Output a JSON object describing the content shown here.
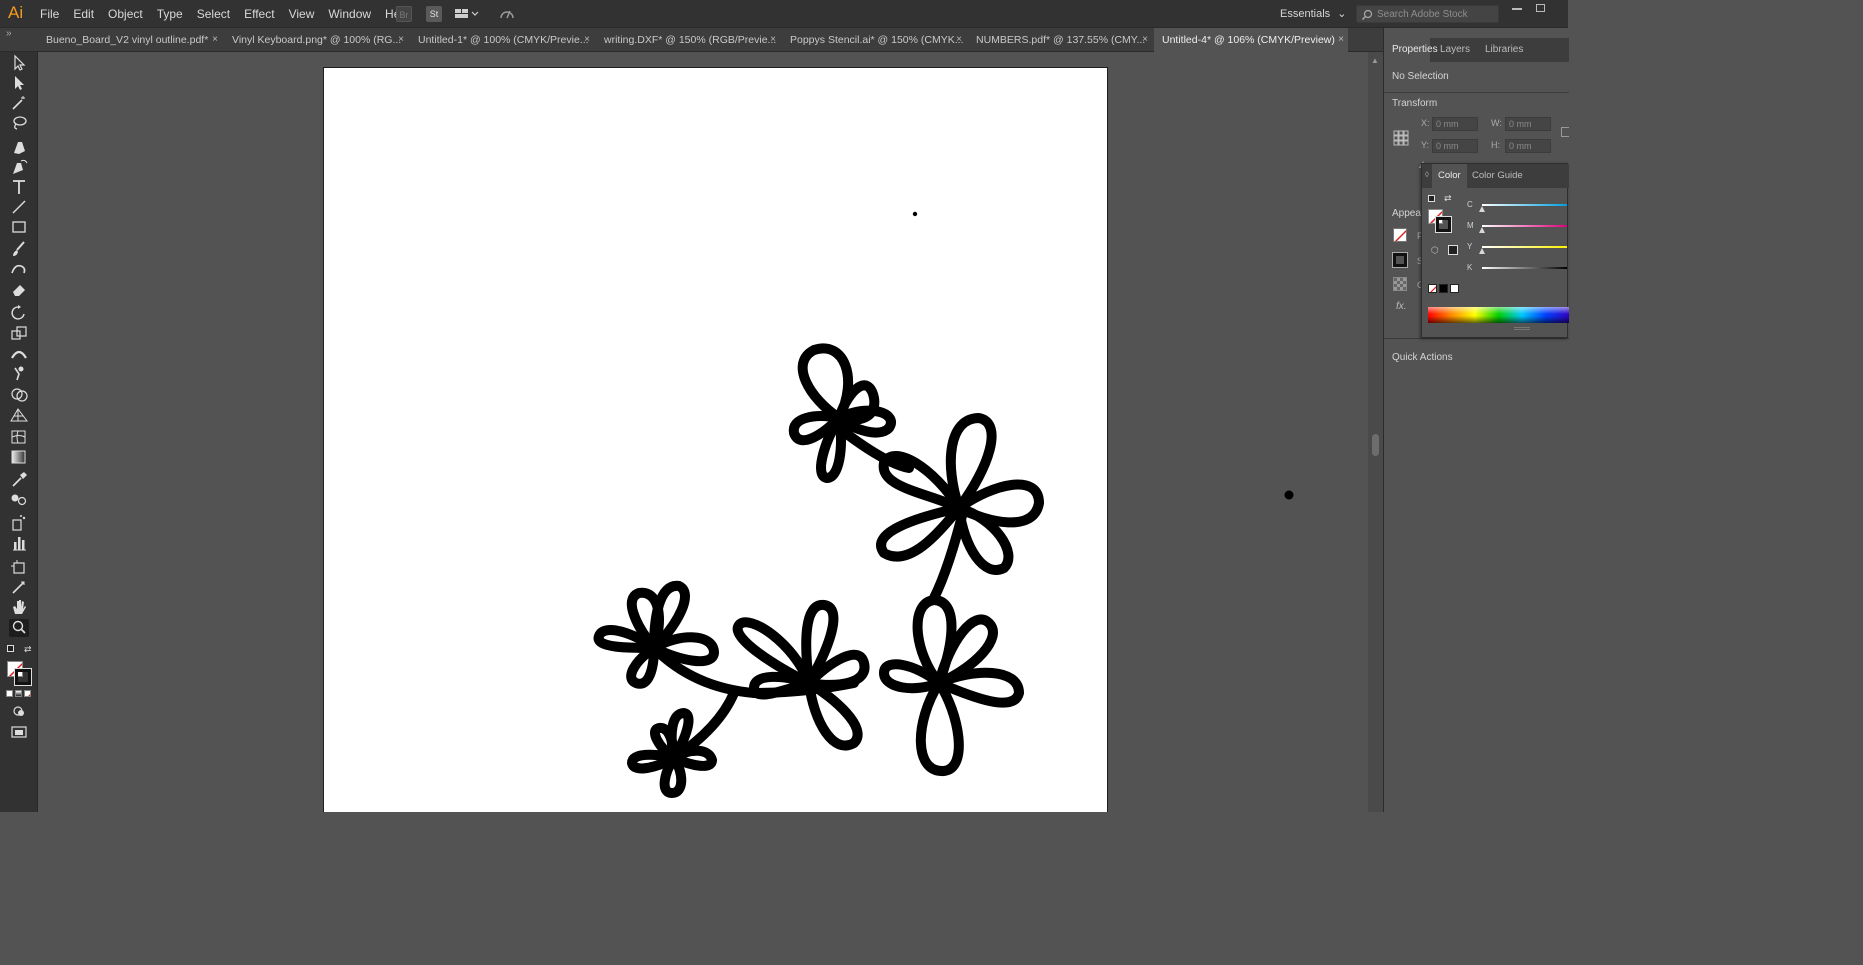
{
  "app": {
    "logo": "Ai"
  },
  "menu": {
    "items": [
      "File",
      "Edit",
      "Object",
      "Type",
      "Select",
      "Effect",
      "View",
      "Window",
      "Help"
    ]
  },
  "menubar_icons": {
    "bridge": "Br",
    "stock": "St"
  },
  "workspace": {
    "label": "Essentials"
  },
  "search": {
    "placeholder": "Search Adobe Stock"
  },
  "tabs": [
    {
      "label": "Bueno_Board_V2 vinyl outline.pdf*",
      "active": false
    },
    {
      "label": "Vinyl Keyboard.png* @ 100% (RG...",
      "active": false
    },
    {
      "label": "Untitled-1* @ 100% (CMYK/Previe...",
      "active": false
    },
    {
      "label": "writing.DXF* @ 150% (RGB/Previe...",
      "active": false
    },
    {
      "label": "Poppys Stencil.ai* @ 150% (CMYK...",
      "active": false
    },
    {
      "label": "NUMBERS.pdf* @ 137.55% (CMY...",
      "active": false
    },
    {
      "label": "Untitled-4* @ 106% (CMYK/Preview)",
      "active": true
    }
  ],
  "tab_close_glyph": "×",
  "toolbar": {
    "tools": [
      "selection-tool",
      "direct-selection-tool",
      "magic-wand-tool",
      "lasso-tool",
      "pen-tool",
      "curvature-tool",
      "type-tool",
      "line-segment-tool",
      "rectangle-tool",
      "paintbrush-tool",
      "shaper-tool",
      "eraser-tool",
      "rotate-tool",
      "scale-tool",
      "width-tool",
      "puppet-warp-tool",
      "shape-builder-tool",
      "perspective-grid-tool",
      "mesh-tool",
      "gradient-tool",
      "eyedropper-tool",
      "blend-tool",
      "symbol-sprayer-tool",
      "column-graph-tool",
      "artboard-tool",
      "slice-tool",
      "hand-tool",
      "zoom-tool"
    ],
    "active_tool": "zoom-tool"
  },
  "panel": {
    "tabs": [
      "Properties",
      "Layers",
      "Libraries"
    ],
    "selection_status": "No Selection",
    "transform_title": "Transform",
    "fields": {
      "x_label": "X:",
      "y_label": "Y:",
      "w_label": "W:",
      "h_label": "H:",
      "x_value": "0 mm",
      "y_value": "0 mm",
      "w_value": "0 mm",
      "h_value": "0 mm"
    },
    "appearance_title": "Appeara",
    "appearance_rows": [
      "F",
      "S",
      "O"
    ],
    "fx_label": "fx.",
    "quick_actions_title": "Quick Actions"
  },
  "color_panel": {
    "tabs": [
      "Color",
      "Color Guide"
    ],
    "sliders": [
      {
        "label": "C",
        "value": 0
      },
      {
        "label": "M",
        "value": 0
      },
      {
        "label": "Y",
        "value": 0
      },
      {
        "label": "K",
        "value": 0
      }
    ]
  },
  "colors": {
    "stroke": "#000000",
    "fill": "none",
    "accent": "#f29a1f"
  }
}
